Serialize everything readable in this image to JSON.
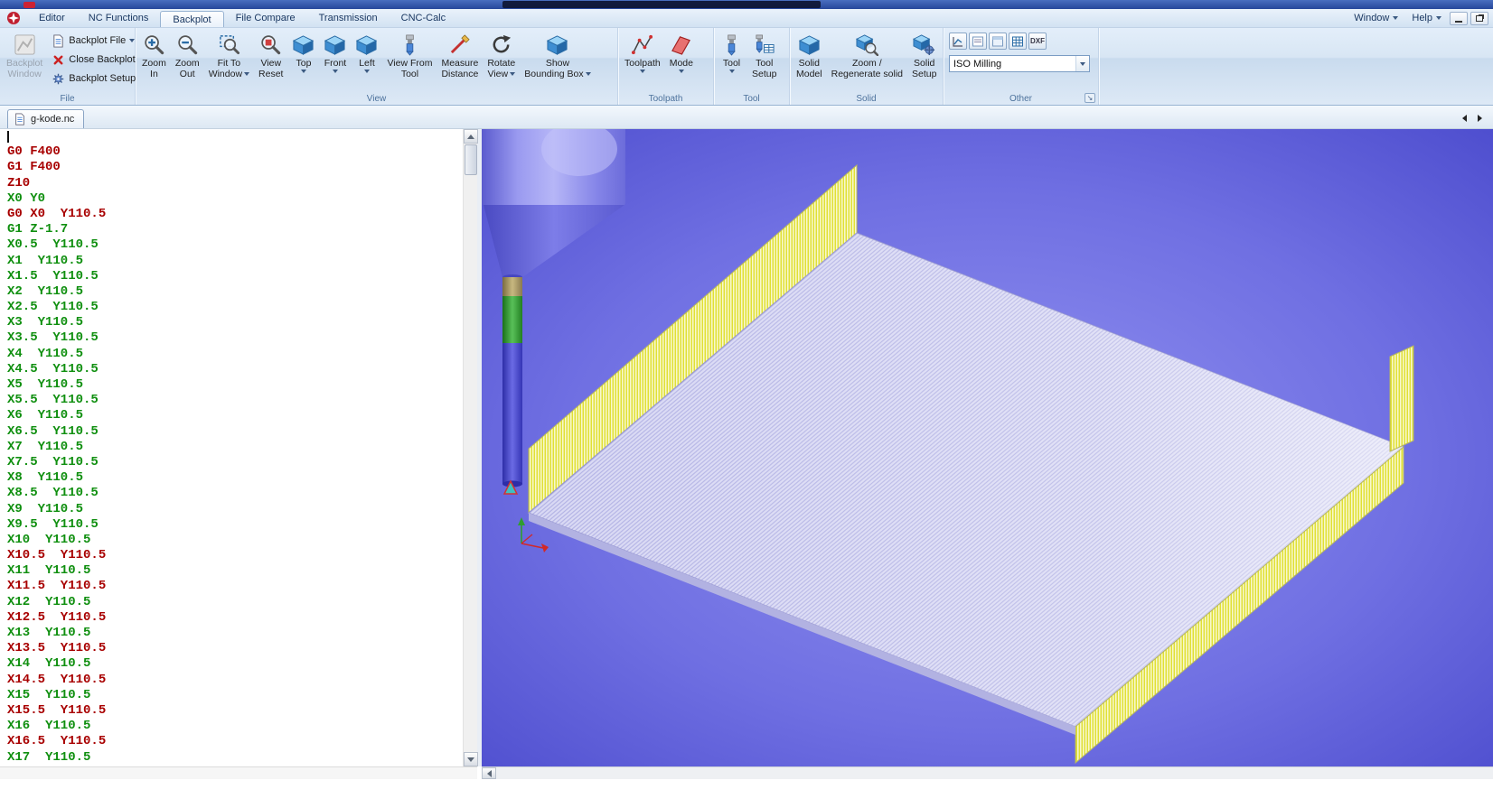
{
  "colors": {
    "editor_red": "#a80000",
    "editor_green": "#0f8f0f",
    "wall_yellow": "#e0e034",
    "surface_lavender": "#d9d9f4",
    "viewport_blue": "#6f6fe2"
  },
  "menubar": {
    "tabs": [
      {
        "label": "Editor",
        "active": ""
      },
      {
        "label": "NC Functions",
        "active": ""
      },
      {
        "label": "Backplot",
        "active": "active"
      },
      {
        "label": "File Compare",
        "active": ""
      },
      {
        "label": "Transmission",
        "active": ""
      },
      {
        "label": "CNC-Calc",
        "active": ""
      }
    ],
    "window_menu": "Window",
    "help_menu": "Help"
  },
  "ribbon": {
    "file_group": {
      "label": "File",
      "backplot_window": {
        "line1": "Backplot",
        "line2": "Window"
      },
      "backplot_file": "Backplot File",
      "close_backplot": "Close Backplot",
      "backplot_setup": "Backplot Setup"
    },
    "view_group": {
      "label": "View",
      "zoom_in": {
        "line1": "Zoom",
        "line2": "In"
      },
      "zoom_out": {
        "line1": "Zoom",
        "line2": "Out"
      },
      "fit_to_window": {
        "line1": "Fit To",
        "line2": "Window"
      },
      "view_reset": {
        "line1": "View",
        "line2": "Reset"
      },
      "top": {
        "line1": "Top"
      },
      "front": {
        "line1": "Front"
      },
      "left": {
        "line1": "Left"
      },
      "view_from_tool": {
        "line1": "View From",
        "line2": "Tool"
      },
      "measure_distance": {
        "line1": "Measure",
        "line2": "Distance"
      },
      "rotate_view": {
        "line1": "Rotate",
        "line2": "View"
      },
      "show_bounding_box": {
        "line1": "Show",
        "line2": "Bounding Box"
      }
    },
    "toolpath_group": {
      "label": "Toolpath",
      "toolpath": {
        "line1": "Toolpath"
      },
      "mode": {
        "line1": "Mode"
      }
    },
    "tool_group": {
      "label": "Tool",
      "tool": {
        "line1": "Tool"
      },
      "tool_setup": {
        "line1": "Tool",
        "line2": "Setup"
      }
    },
    "solid_group": {
      "label": "Solid",
      "solid_model": {
        "line1": "Solid",
        "line2": "Model"
      },
      "zoom_regenerate": {
        "line1": "Zoom /",
        "line2": "Regenerate solid"
      },
      "solid_setup": {
        "line1": "Solid",
        "line2": "Setup"
      }
    },
    "other_group": {
      "label": "Other",
      "dxf": "DXF",
      "machine_type": "ISO Milling"
    }
  },
  "tabbar": {
    "document_tab": "g-kode.nc"
  },
  "editor": {
    "lines": [
      {
        "text": "G0 F400",
        "color": "red"
      },
      {
        "text": "G1 F400",
        "color": "red"
      },
      {
        "text": "Z10",
        "color": "red"
      },
      {
        "text": "X0 Y0",
        "color": "green"
      },
      {
        "text": "G0 X0  Y110.5",
        "color": "red"
      },
      {
        "text": "G1 Z-1.7",
        "color": "green"
      },
      {
        "text": "X0.5  Y110.5",
        "color": "green"
      },
      {
        "text": "X1  Y110.5",
        "color": "green"
      },
      {
        "text": "X1.5  Y110.5",
        "color": "green"
      },
      {
        "text": "X2  Y110.5",
        "color": "green"
      },
      {
        "text": "X2.5  Y110.5",
        "color": "green"
      },
      {
        "text": "X3  Y110.5",
        "color": "green"
      },
      {
        "text": "X3.5  Y110.5",
        "color": "green"
      },
      {
        "text": "X4  Y110.5",
        "color": "green"
      },
      {
        "text": "X4.5  Y110.5",
        "color": "green"
      },
      {
        "text": "X5  Y110.5",
        "color": "green"
      },
      {
        "text": "X5.5  Y110.5",
        "color": "green"
      },
      {
        "text": "X6  Y110.5",
        "color": "green"
      },
      {
        "text": "X6.5  Y110.5",
        "color": "green"
      },
      {
        "text": "X7  Y110.5",
        "color": "green"
      },
      {
        "text": "X7.5  Y110.5",
        "color": "green"
      },
      {
        "text": "X8  Y110.5",
        "color": "green"
      },
      {
        "text": "X8.5  Y110.5",
        "color": "green"
      },
      {
        "text": "X9  Y110.5",
        "color": "green"
      },
      {
        "text": "X9.5  Y110.5",
        "color": "green"
      },
      {
        "text": "X10  Y110.5",
        "color": "green"
      },
      {
        "text": "X10.5  Y110.5",
        "color": "red"
      },
      {
        "text": "X11  Y110.5",
        "color": "green"
      },
      {
        "text": "X11.5  Y110.5",
        "color": "red"
      },
      {
        "text": "X12  Y110.5",
        "color": "green"
      },
      {
        "text": "X12.5  Y110.5",
        "color": "red"
      },
      {
        "text": "X13  Y110.5",
        "color": "green"
      },
      {
        "text": "X13.5  Y110.5",
        "color": "red"
      },
      {
        "text": "X14  Y110.5",
        "color": "green"
      },
      {
        "text": "X14.5  Y110.5",
        "color": "red"
      },
      {
        "text": "X15  Y110.5",
        "color": "green"
      },
      {
        "text": "X15.5  Y110.5",
        "color": "red"
      },
      {
        "text": "X16  Y110.5",
        "color": "green"
      },
      {
        "text": "X16.5  Y110.5",
        "color": "red"
      },
      {
        "text": "X17  Y110.5",
        "color": "green"
      }
    ]
  }
}
